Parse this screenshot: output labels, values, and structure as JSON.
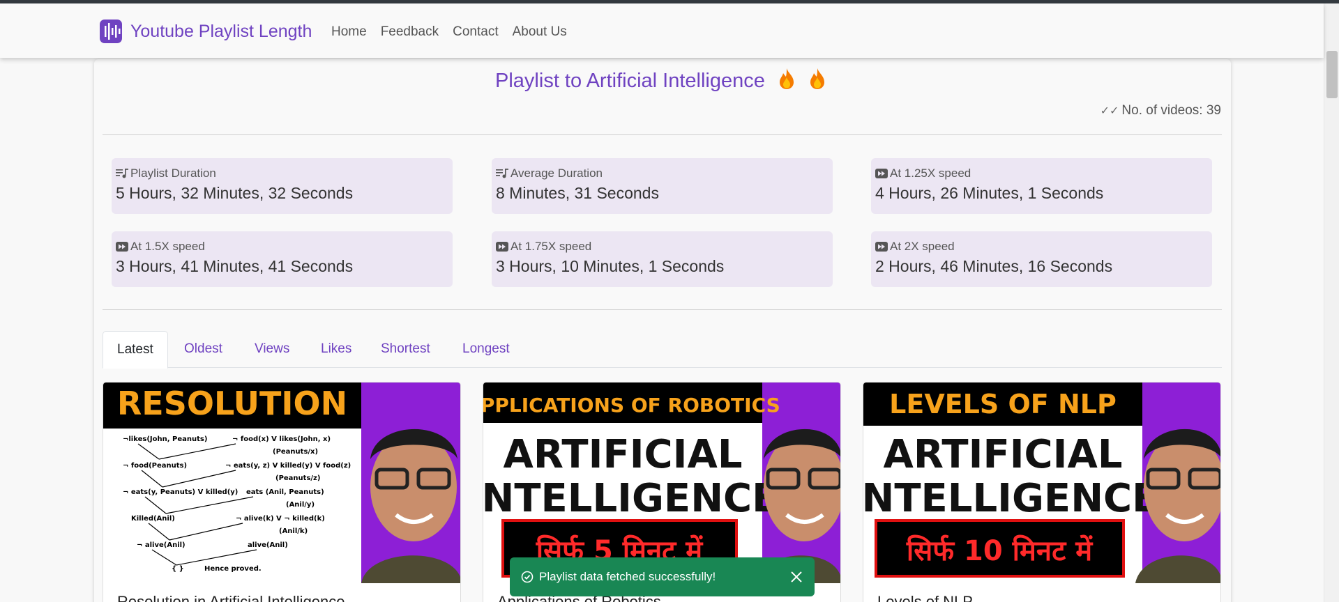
{
  "brand": {
    "name": "Youtube Playlist Length",
    "accent": "#6f42c1"
  },
  "nav": {
    "items": [
      {
        "label": "Home"
      },
      {
        "label": "Feedback"
      },
      {
        "label": "Contact"
      },
      {
        "label": "About Us"
      }
    ]
  },
  "playlist": {
    "title": "Playlist to Artificial Intelligence",
    "title_icon": "fire-icon",
    "video_count_label": "No. of videos: 39"
  },
  "stats": [
    {
      "icon": "playlist-music-icon",
      "label": "Playlist Duration",
      "value": "5 Hours, 32 Minutes, 32 Seconds"
    },
    {
      "icon": "playlist-music-icon",
      "label": "Average Duration",
      "value": "8 Minutes, 31 Seconds"
    },
    {
      "icon": "fast-forward-icon",
      "label": "At 1.25X speed",
      "value": "4 Hours, 26 Minutes, 1 Seconds"
    },
    {
      "icon": "fast-forward-icon",
      "label": "At 1.5X speed",
      "value": "3 Hours, 41 Minutes, 41 Seconds"
    },
    {
      "icon": "fast-forward-icon",
      "label": "At 1.75X speed",
      "value": "3 Hours, 10 Minutes, 1 Seconds"
    },
    {
      "icon": "fast-forward-icon",
      "label": "At 2X speed",
      "value": "2 Hours, 46 Minutes, 16 Seconds"
    }
  ],
  "tabs": {
    "active": "Latest",
    "items": [
      {
        "label": "Latest"
      },
      {
        "label": "Oldest"
      },
      {
        "label": "Views"
      },
      {
        "label": "Likes"
      },
      {
        "label": "Shortest"
      },
      {
        "label": "Longest"
      }
    ]
  },
  "videos": [
    {
      "thumb_banner": "RESOLUTION",
      "thumb_lines": [
        "¬likes(John, Peanuts)",
        "¬ food(x) V likes(John, x)",
        "(Peanuts/x)",
        "¬ food(Peanuts)",
        "¬ eats(y, z) V killed(y) V food(z)",
        "(Peanuts/z)",
        "¬ eats(y, Peanuts) V killed(y)",
        "eats (Anil, Peanuts)",
        "(Anil/y)",
        "Killed(Anil)",
        "¬ alive(k) V ¬ killed(k)",
        "(Anil/k)",
        "¬ alive(Anil)",
        "alive(Anil)",
        "{ }",
        "Hence proved."
      ],
      "title": "Resolution in Artificial Intelligence"
    },
    {
      "thumb_banner": "APPLICATIONS OF ROBOTICS",
      "thumb_main": [
        "ARTIFICIAL",
        "INTELLIGENCE"
      ],
      "thumb_hindi": "सिर्फ 5 मिनट में",
      "title": "Applications of Robotics"
    },
    {
      "thumb_banner": "LEVELS OF NLP",
      "thumb_main": [
        "ARTIFICIAL",
        "INTELLIGENCE"
      ],
      "thumb_hindi": "सिर्फ 10 मिनट में",
      "title": "Levels of NLP"
    }
  ],
  "toast": {
    "message": "Playlist data fetched successfully!",
    "color": "#198754",
    "icon": "check-circle-icon",
    "close_icon": "close-icon"
  }
}
